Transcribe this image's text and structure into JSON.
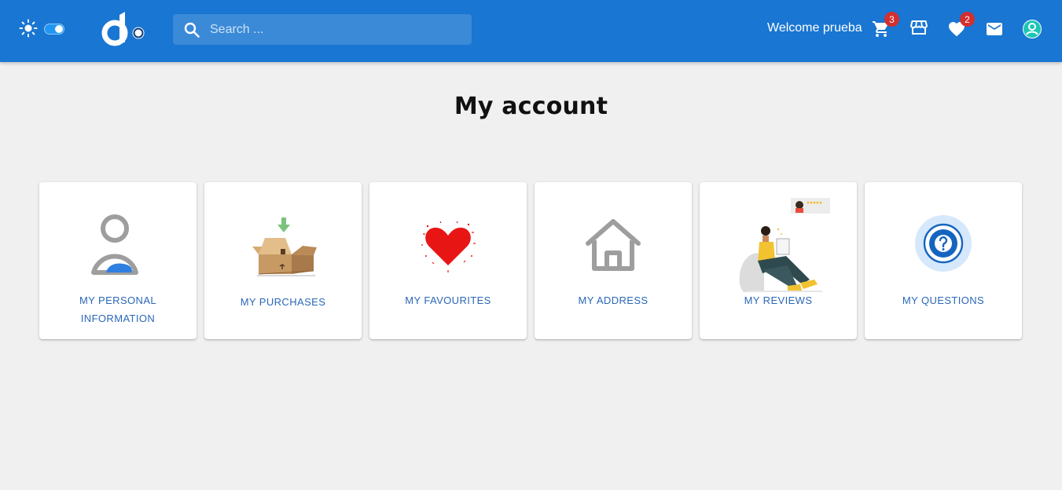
{
  "header": {
    "search_placeholder": "Search ...",
    "welcome_text": "Welcome prueba",
    "cart_count": "3",
    "favourites_count": "2"
  },
  "colors": {
    "appbar": "#1976d2",
    "badge": "#d32f2f",
    "card_label": "#2a67b8",
    "background": "#f0f0f0"
  },
  "icons": [
    "sun-icon",
    "theme-toggle",
    "moon-icon",
    "logo",
    "search-icon",
    "cart-icon",
    "store-icon",
    "heart-icon",
    "mail-icon",
    "account-icon"
  ],
  "page": {
    "title": "My account"
  },
  "cards": [
    {
      "label": "MY PERSONAL INFORMATION",
      "icon": "person-icon"
    },
    {
      "label": "MY PURCHASES",
      "icon": "box-icon"
    },
    {
      "label": "MY FAVOURITES",
      "icon": "heart-illustration"
    },
    {
      "label": "MY ADDRESS",
      "icon": "house-icon"
    },
    {
      "label": "MY REVIEWS",
      "icon": "review-illustration"
    },
    {
      "label": "MY QUESTIONS",
      "icon": "question-icon"
    }
  ]
}
